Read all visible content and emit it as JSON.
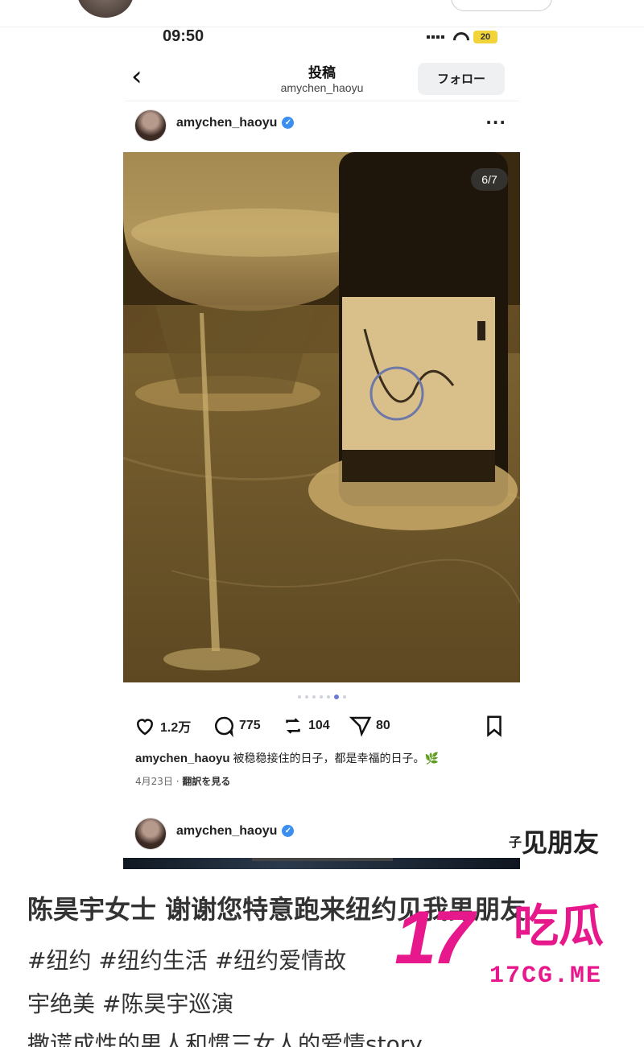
{
  "status_bar": {
    "time": "09:50",
    "battery": "20"
  },
  "nav": {
    "back_icon": "chevron-left-icon",
    "title": "投稿",
    "subtitle": "amychen_haoyu",
    "follow_label": "フォロー"
  },
  "post": {
    "username": "amychen_haoyu",
    "more_icon": "more-dots-icon",
    "page_indicator": "6/7",
    "carousel": {
      "total": 7,
      "current": 6
    },
    "likes": "1.2万",
    "comments": "775",
    "reposts": "104",
    "shares": "80",
    "caption_user": "amychen_haoyu",
    "caption_text": "被稳稳接住的日子，都是幸福的日子。",
    "caption_emoji": "🌿",
    "date": "4月23日",
    "translate_label": "翻訳を見る"
  },
  "post2": {
    "username": "amychen_haoyu"
  },
  "side_text": {
    "small": "子",
    "big": "见朋友"
  },
  "article": {
    "title": "陈昊宇女士 谢谢您特意跑来纽约见我男朋友",
    "tags_line1": "#纽约 #纽约生活 #纽约爱情故",
    "tags_line2": "宇绝美 #陈昊宇巡演",
    "line3": "撒谎成性的男人和惯三女人的爱情story"
  },
  "watermark": {
    "number": "17",
    "chinese": "吃瓜",
    "url": "17CG.ME"
  }
}
